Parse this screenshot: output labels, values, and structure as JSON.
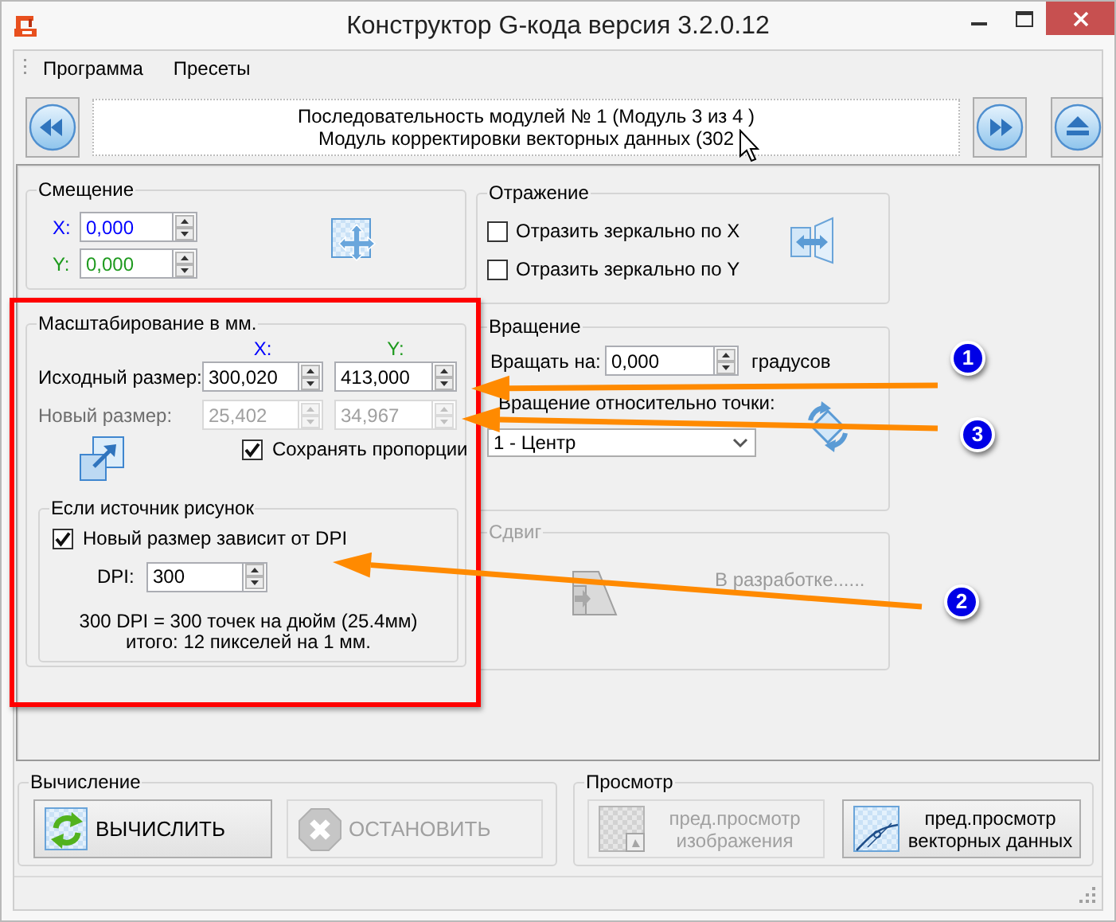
{
  "window": {
    "title": "Конструктор G-кода версия 3.2.0.12"
  },
  "menu": [
    {
      "label": "Программа"
    },
    {
      "label": "Пресеты"
    }
  ],
  "sequence_panel": {
    "lines": [
      "Последовательность модулей № 1 (Модуль 3 из 4 )",
      "Модуль корректировки векторных данных (302"
    ]
  },
  "offset": {
    "title": "Смещение",
    "fields": [
      {
        "label": "X:",
        "value": "0,000",
        "color": "#0000ff"
      },
      {
        "label": "Y:",
        "value": "0,000",
        "color": "#1e9a1e"
      }
    ]
  },
  "scaling": {
    "title": "Масштабирование в мм.",
    "axes": [
      {
        "label": "X:",
        "color": "#0000ff"
      },
      {
        "label": "Y:",
        "color": "#1e9a1e"
      }
    ],
    "rows": [
      {
        "label": "Исходный размер:",
        "disabled": false,
        "values": [
          "300,020",
          "413,000"
        ]
      },
      {
        "label": "Новый размер:",
        "disabled": true,
        "values": [
          "25,402",
          "34,967"
        ]
      }
    ],
    "keep_proportions": {
      "label": "Сохранять пропорции",
      "checked": true
    },
    "dpi_group": {
      "title": "Если источник рисунок",
      "depends_on_dpi": {
        "label": "Новый размер зависит от DPI",
        "checked": true
      },
      "dpi": {
        "label": "DPI:",
        "value": "300"
      },
      "info": [
        "300 DPI = 300 точек на дюйм (25.4мм)",
        "итого: 12 пикселей на 1 мм."
      ]
    }
  },
  "mirror": {
    "title": "Отражение",
    "options": [
      {
        "label": "Отразить зеркально по X",
        "checked": false
      },
      {
        "label": "Отразить зеркально по Y",
        "checked": false
      }
    ]
  },
  "rotation": {
    "title": "Вращение",
    "angle": {
      "label": "Вращать на:",
      "value": "0,000",
      "unit": "градусов"
    },
    "pivot": {
      "label": "Вращение относительно точки:",
      "value": "1 - Центр"
    }
  },
  "shear": {
    "title": "Сдвиг",
    "disabled": true,
    "note": "В разработке......"
  },
  "calculation": {
    "title": "Вычисление",
    "buttons": [
      {
        "kind": "calculate",
        "lines": [
          "ВЫЧИСЛИТЬ"
        ],
        "disabled": false
      },
      {
        "kind": "stop",
        "lines": [
          "ОСТАНОВИТЬ"
        ],
        "disabled": true
      }
    ]
  },
  "preview": {
    "title": "Просмотр",
    "buttons": [
      {
        "kind": "image",
        "lines": [
          "пред.просмотр",
          "изображения"
        ],
        "disabled": true
      },
      {
        "kind": "vector",
        "lines": [
          "пред.просмотр",
          "векторных данных"
        ],
        "disabled": false
      }
    ]
  },
  "annotations": {
    "markers": [
      {
        "label": "1"
      },
      {
        "label": "3"
      },
      {
        "label": "2"
      }
    ]
  }
}
